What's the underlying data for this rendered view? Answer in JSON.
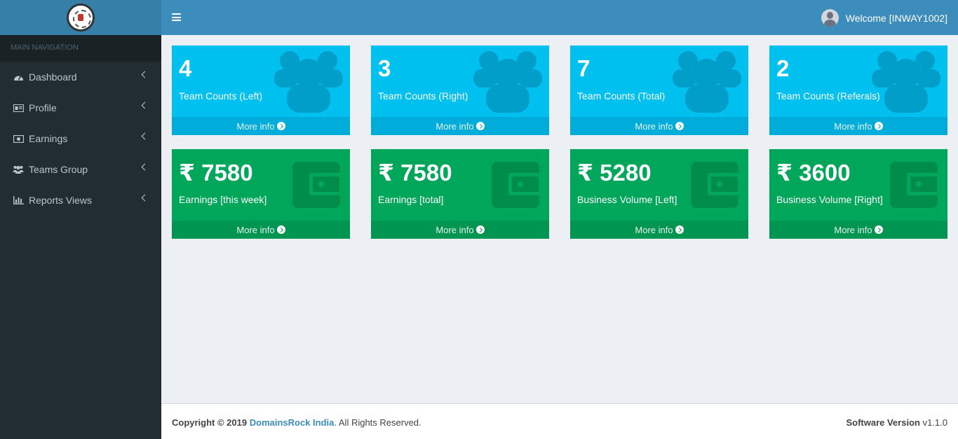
{
  "sidebar": {
    "header": "MAIN NAVIGATION",
    "items": [
      {
        "label": "Dashboard",
        "icon": "dashboard-icon"
      },
      {
        "label": "Profile",
        "icon": "id-card-icon"
      },
      {
        "label": "Earnings",
        "icon": "money-icon"
      },
      {
        "label": "Teams Group",
        "icon": "users-icon"
      },
      {
        "label": "Reports Views",
        "icon": "bar-chart-icon"
      }
    ]
  },
  "header": {
    "welcome": "Welcome [INWAY1002]"
  },
  "stats": [
    {
      "value": "4",
      "label": "Team Counts (Left)",
      "link": "More info"
    },
    {
      "value": "3",
      "label": "Team Counts (Right)",
      "link": "More info"
    },
    {
      "value": "7",
      "label": "Team Counts (Total)",
      "link": "More info"
    },
    {
      "value": "2",
      "label": "Team Counts (Referals)",
      "link": "More info"
    },
    {
      "value": "₹ 7580",
      "label": "Earnings [this week]",
      "link": "More info"
    },
    {
      "value": "₹ 7580",
      "label": "Earnings [total]",
      "link": "More info"
    },
    {
      "value": "₹ 5280",
      "label": "Business Volume [Left]",
      "link": "More info"
    },
    {
      "value": "₹ 3600",
      "label": "Business Volume [Right]",
      "link": "More info"
    }
  ],
  "colors": {
    "aqua": "#00c0ef",
    "green": "#00a65a",
    "header": "#3c8dbc",
    "sidebar": "#222d32"
  },
  "footer": {
    "copyright": "Copyright © 2019",
    "company": "DomainsRock India",
    "rights": ". All Rights Reserved.",
    "version_label": "Software Version",
    "version": "v1.1.0"
  }
}
